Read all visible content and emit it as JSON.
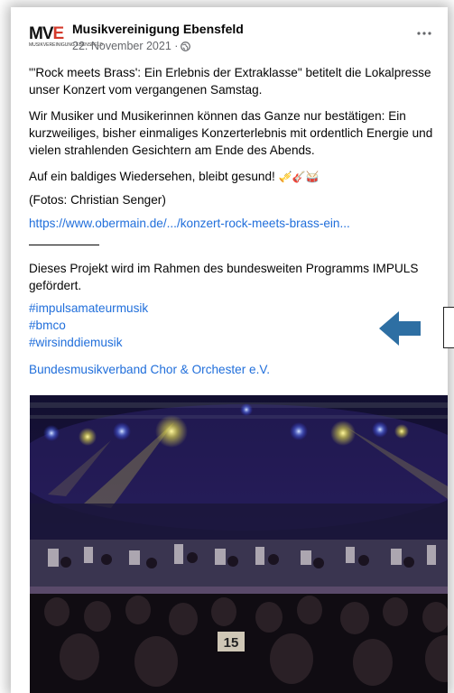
{
  "post": {
    "logo": {
      "mark_m": "M",
      "mark_v": "V",
      "mark_e": "E",
      "subtitle": "MUSIKVEREINIGUNG EBENSFELD"
    },
    "page_name": "Musikvereinigung Ebensfeld",
    "date": "22. November 2021 ·",
    "paragraphs": [
      "\"'Rock meets Brass': Ein Erlebnis der Extraklasse\" betitelt die Lokalpresse unser Konzert vom vergangenen Samstag.",
      "Wir Musiker und Musikerinnen können das Ganze nur bestätigen: Ein kurzweiliges, bisher einmaliges Konzerterlebnis mit ordentlich Energie und vielen strahlenden Gesichtern am Ende des Abends.",
      "Auf ein baldiges Wiedersehen, bleibt gesund!",
      "(Fotos: Christian Senger)"
    ],
    "emojis": "🎺🎸🥁",
    "article_link": "https://www.obermain.de/.../konzert-rock-meets-brass-ein...",
    "funding_note": "Dieses Projekt wird im Rahmen des bundesweiten Programms IMPULS gefördert.",
    "hashtags": [
      "#impulsamateurmusik",
      "#bmco",
      "#wirsinddiemusik"
    ],
    "org_link": "Bundesmusikverband Chor & Orchester e.V.",
    "photo_sign": "15"
  },
  "colors": {
    "link": "#216fdb",
    "arrow": "#2e6fa3",
    "logo_accent": "#d43a2b"
  },
  "icons": {
    "more": "more-options-icon",
    "audience": "globe-icon",
    "arrow": "left-arrow-icon"
  }
}
